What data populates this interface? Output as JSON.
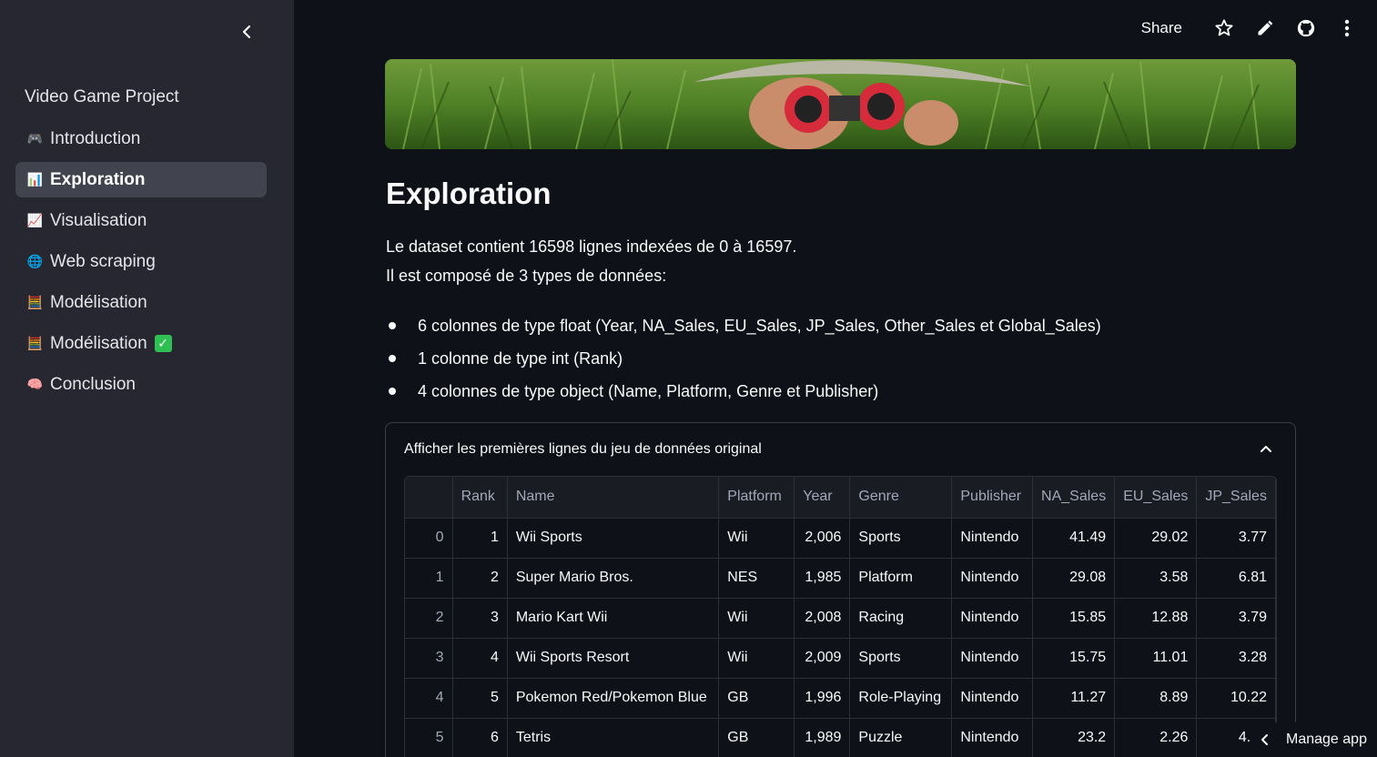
{
  "sidebar": {
    "title": "Video Game Project",
    "items": [
      {
        "emoji": "🎮",
        "label": "Introduction",
        "active": false
      },
      {
        "emoji": "📊",
        "label": "Exploration",
        "active": true
      },
      {
        "emoji": "📈",
        "label": "Visualisation",
        "active": false
      },
      {
        "emoji": "🌐",
        "label": "Web scraping",
        "active": false
      },
      {
        "emoji": "🧮",
        "label": "Modélisation",
        "active": false
      },
      {
        "emoji": "🧮",
        "label": "Modélisation",
        "active": false,
        "badge": "✓"
      },
      {
        "emoji": "🧠",
        "label": "Conclusion",
        "active": false
      }
    ]
  },
  "header": {
    "share_label": "Share"
  },
  "main": {
    "title": "Exploration",
    "para1": "Le dataset contient 16598 lignes indexées de 0 à 16597.",
    "para2": "Il est composé de 3 types de données:",
    "bullets": [
      "6 colonnes de type float (Year, NA_Sales, EU_Sales, JP_Sales, Other_Sales et Global_Sales)",
      "1 colonne de type int (Rank)",
      "4 colonnes de type object (Name, Platform, Genre et Publisher)"
    ],
    "expander_label": "Afficher les premières lignes du jeu de données original"
  },
  "table": {
    "columns": [
      "",
      "Rank",
      "Name",
      "Platform",
      "Year",
      "Genre",
      "Publisher",
      "NA_Sales",
      "EU_Sales",
      "JP_Sales"
    ],
    "rows": [
      [
        "0",
        "1",
        "Wii Sports",
        "Wii",
        "2,006",
        "Sports",
        "Nintendo",
        "41.49",
        "29.02",
        "3.77"
      ],
      [
        "1",
        "2",
        "Super Mario Bros.",
        "NES",
        "1,985",
        "Platform",
        "Nintendo",
        "29.08",
        "3.58",
        "6.81"
      ],
      [
        "2",
        "3",
        "Mario Kart Wii",
        "Wii",
        "2,008",
        "Racing",
        "Nintendo",
        "15.85",
        "12.88",
        "3.79"
      ],
      [
        "3",
        "4",
        "Wii Sports Resort",
        "Wii",
        "2,009",
        "Sports",
        "Nintendo",
        "15.75",
        "11.01",
        "3.28"
      ],
      [
        "4",
        "5",
        "Pokemon Red/Pokemon Blue",
        "GB",
        "1,996",
        "Role-Playing",
        "Nintendo",
        "11.27",
        "8.89",
        "10.22"
      ],
      [
        "5",
        "6",
        "Tetris",
        "GB",
        "1,989",
        "Puzzle",
        "Nintendo",
        "23.2",
        "2.26",
        "4.22"
      ]
    ]
  },
  "footer": {
    "manage_label": "Manage app"
  }
}
